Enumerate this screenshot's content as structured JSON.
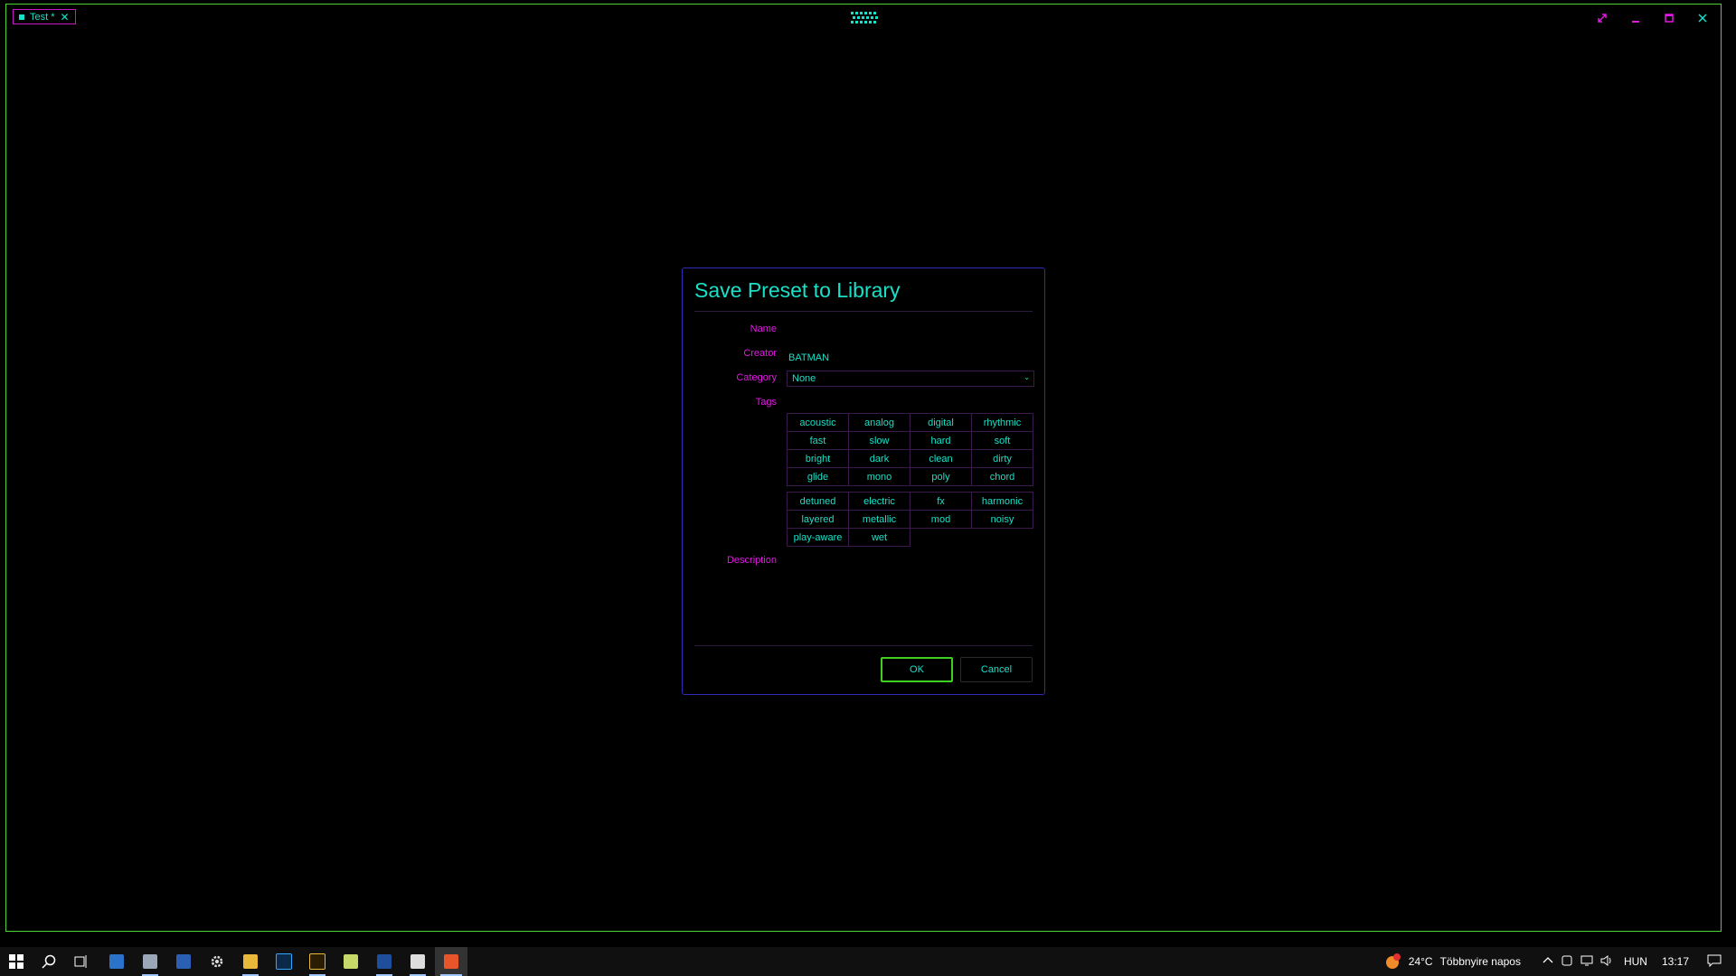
{
  "window": {
    "tab_label": "Test *",
    "tab_close": "✕",
    "controls": {
      "restore": "restore-icon",
      "minimize": "minimize-icon",
      "maximize": "maximize-icon",
      "close": "close-icon"
    },
    "accent_color": "#19e0c8",
    "label_color": "#e219e2",
    "border_color": "#4fd13a"
  },
  "dialog": {
    "title": "Save Preset to Library",
    "labels": {
      "name": "Name",
      "creator": "Creator",
      "category": "Category",
      "tags": "Tags",
      "description": "Description"
    },
    "name_value": "",
    "creator_value": "BATMAN",
    "category_value": "None",
    "tags_group1": [
      "acoustic",
      "analog",
      "digital",
      "rhythmic",
      "fast",
      "slow",
      "hard",
      "soft",
      "bright",
      "dark",
      "clean",
      "dirty",
      "glide",
      "mono",
      "poly",
      "chord"
    ],
    "tags_group2": [
      "detuned",
      "electric",
      "fx",
      "harmonic",
      "layered",
      "metallic",
      "mod",
      "noisy",
      "play-aware",
      "wet"
    ],
    "description_value": "",
    "ok_label": "OK",
    "cancel_label": "Cancel"
  },
  "taskbar": {
    "apps": [
      "start",
      "search",
      "task-view",
      "outlook",
      "notes",
      "app",
      "settings",
      "file-explorer",
      "photoshop",
      "illustrator",
      "notepad",
      "powershell",
      "inkscape",
      "synth-app"
    ],
    "weather_temp": "24°C",
    "weather_text": "Többnyire napos",
    "language": "HUN",
    "time": "13:17",
    "notification_badge": "1"
  }
}
